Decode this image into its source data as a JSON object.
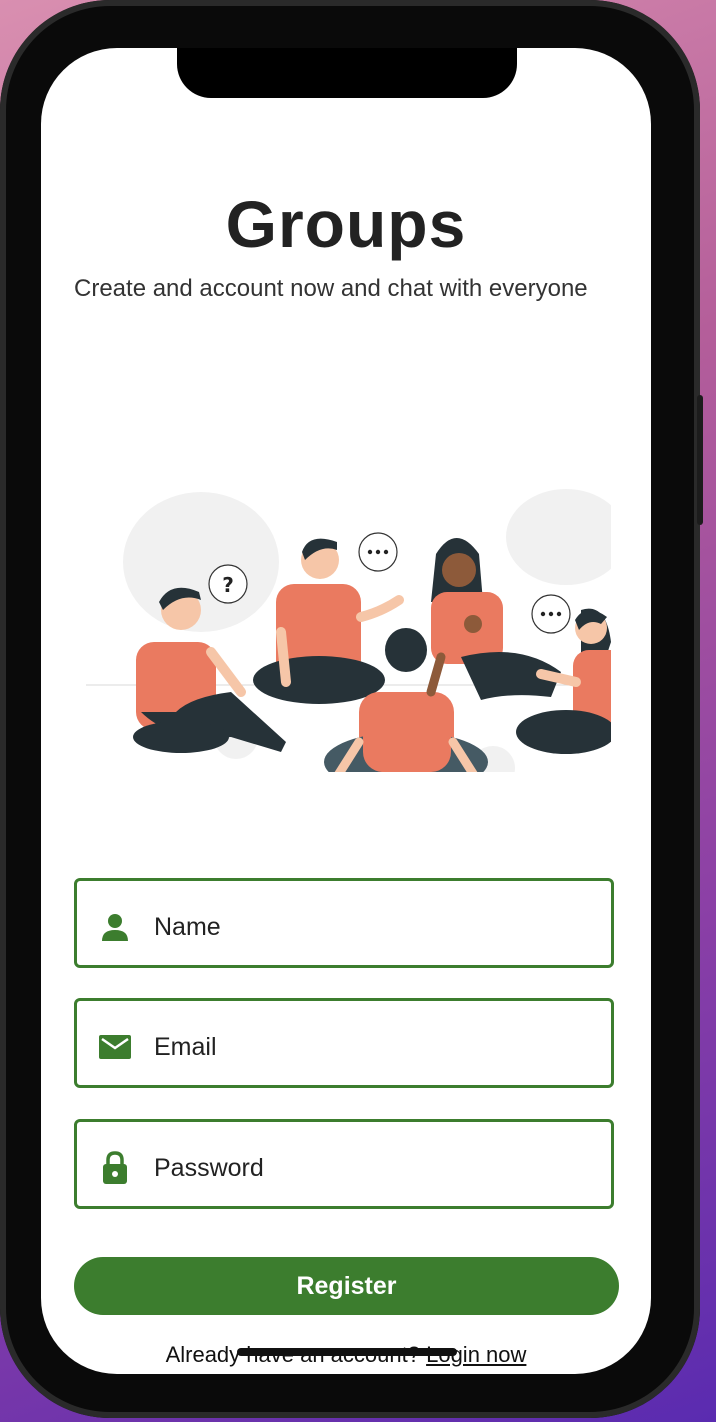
{
  "app": {
    "title": "Groups",
    "subtitle": "Create and account now and chat with everyone"
  },
  "illustration": {
    "name": "people-sitting-chatting-illustration"
  },
  "form": {
    "name": {
      "placeholder": "Name",
      "icon": "person-icon"
    },
    "email": {
      "placeholder": "Email",
      "icon": "envelope-icon"
    },
    "password": {
      "placeholder": "Password",
      "icon": "lock-icon"
    },
    "register_label": "Register"
  },
  "footer": {
    "prompt": "Already have an account? ",
    "login_label": "Login now"
  },
  "colors": {
    "accent": "#3c7d2e",
    "figure_shirt": "#ea7a60",
    "background_top": "#d98fb0",
    "background_bottom": "#5a2bb0"
  }
}
